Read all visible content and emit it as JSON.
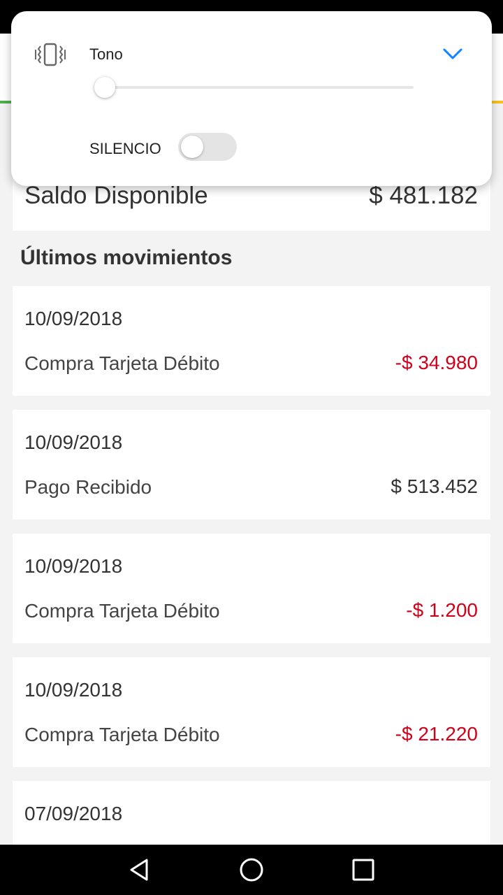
{
  "volume_panel": {
    "mode_label": "Tono",
    "level": 0.03,
    "silence_label": "SILENCIO",
    "silence_on": false,
    "icons": {
      "mode": "vibrate-icon",
      "expand": "chevron-down-icon"
    },
    "colors": {
      "accent": "#0a84ff"
    }
  },
  "balance": {
    "label": "Saldo Disponible",
    "value": "$ 481.182"
  },
  "movements": {
    "title": "Últimos movimientos",
    "items": [
      {
        "date": "10/09/2018",
        "description": "Compra Tarjeta Débito",
        "amount": "-$ 34.980",
        "negative": true
      },
      {
        "date": "10/09/2018",
        "description": "Pago Recibido",
        "amount": "$ 513.452",
        "negative": false
      },
      {
        "date": "10/09/2018",
        "description": "Compra Tarjeta Débito",
        "amount": "-$ 1.200",
        "negative": true
      },
      {
        "date": "10/09/2018",
        "description": "Compra Tarjeta Débito",
        "amount": "-$ 21.220",
        "negative": true
      },
      {
        "date": "07/09/2018",
        "description": "",
        "amount": "",
        "negative": false
      }
    ]
  },
  "colors": {
    "negative_amount": "#d0021b",
    "accent_green": "#4caf50",
    "accent_yellow": "#f7c21b"
  },
  "nav_bar": {
    "icons": [
      "back-icon",
      "home-icon",
      "recents-icon"
    ]
  }
}
